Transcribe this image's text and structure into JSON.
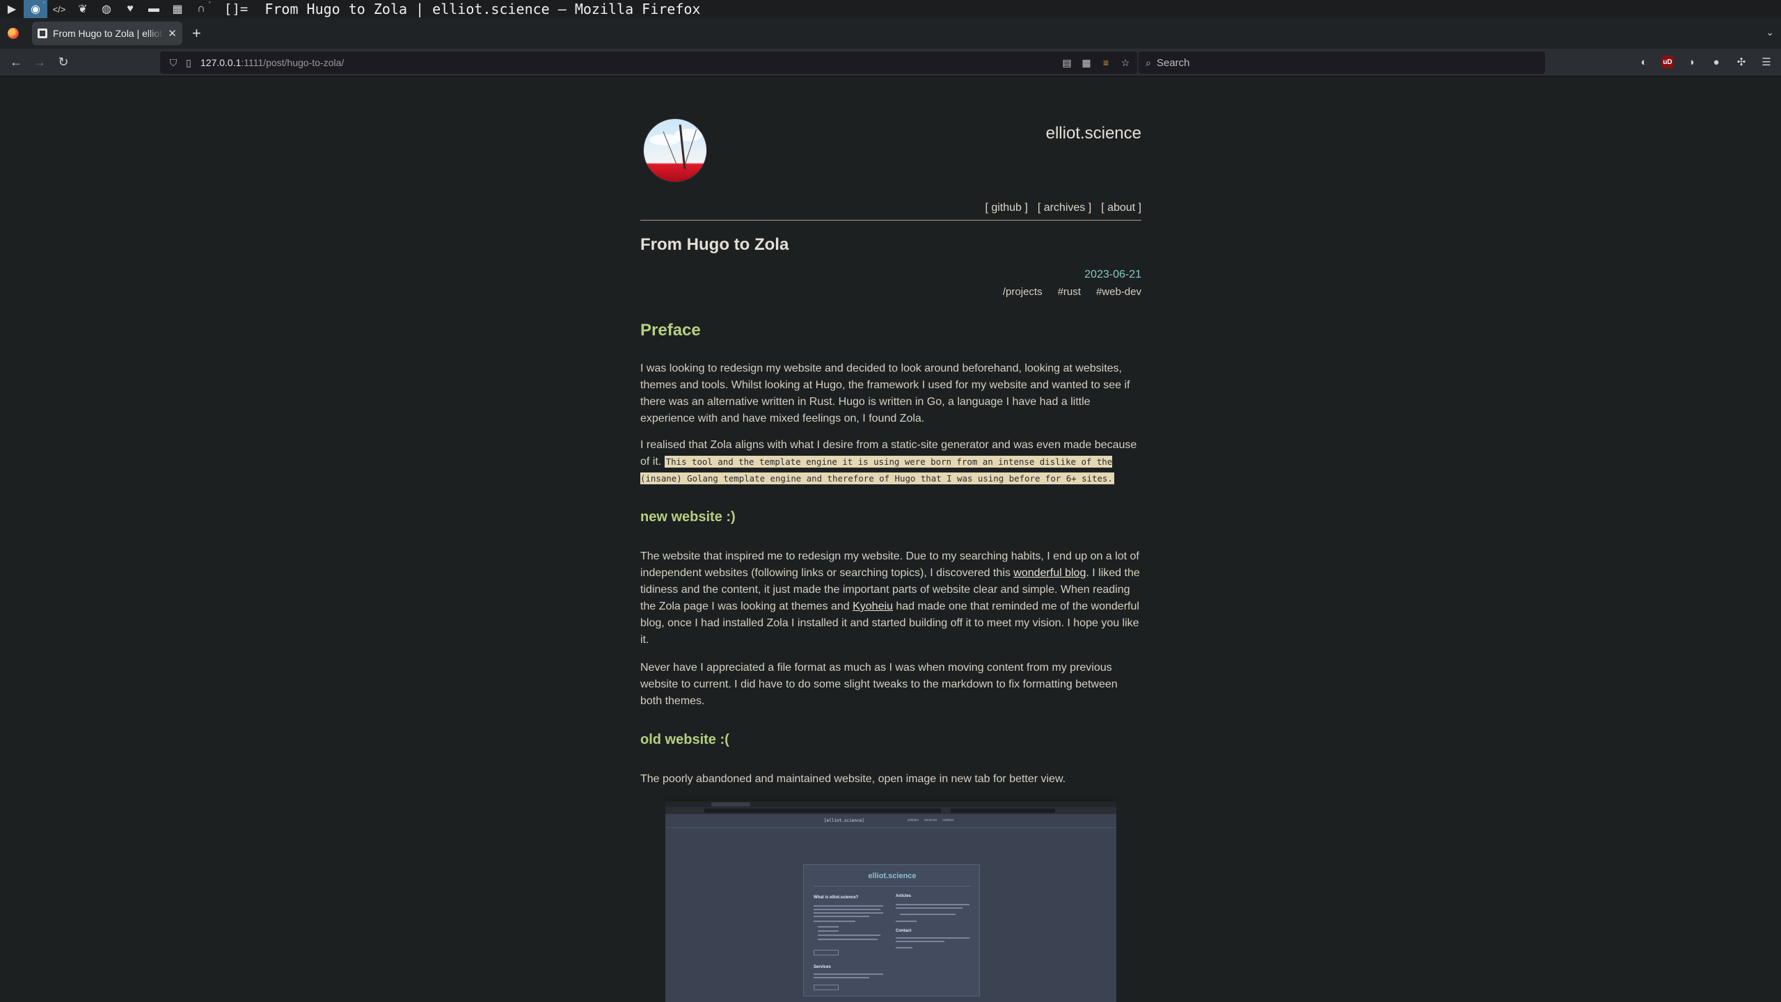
{
  "wm": {
    "layout_indicator": "[]=",
    "window_title": "From Hugo to Zola | elliot.science — Mozilla Firefox"
  },
  "browser": {
    "tab_title": "From Hugo to Zola | elliot.science",
    "url_host": "127.0.0.1",
    "url_rest": ":1111/post/hugo-to-zola/",
    "search_placeholder": "Search"
  },
  "site": {
    "title": "elliot.science",
    "nav": [
      "[ github ]",
      "[ archives ]",
      "[ about ]"
    ]
  },
  "post": {
    "title": "From Hugo to Zola",
    "date": "2023-06-21",
    "tags": [
      "/projects",
      "#rust",
      "#web-dev"
    ],
    "preface_heading": "Preface",
    "preface_p1": "I was looking to redesign my website and decided to look around beforehand, looking at websites, themes and tools. Whilst looking at Hugo, the framework I used for my website and wanted to see if there was an alternative written in Rust. Hugo is written in Go, a language I have had a little experience with and have mixed feelings on, I found Zola.",
    "preface_p2_lead": "I realised that Zola aligns with what I desire from a static-site generator and was even made because of it.",
    "preface_p2_quote": "This tool and the template engine it is using were born from an intense dislike of the (insane) Golang template engine and therefore of Hugo that I was using before for 6+ sites.",
    "new_heading": "new website :)",
    "new_p1_a": "The website that inspired me to redesign my website. Due to my searching habits, I end up on a lot of independent websites (following links or searching topics), I discovered this",
    "new_p1_link1": "wonderful blog",
    "new_p1_b": ". I liked the tidiness and the content, it just made the important parts of website clear and simple. When reading the Zola page I was looking at themes and",
    "new_p1_link2": "Kyoheiu",
    "new_p1_c": "had made one that reminded me of the wonderful blog, once I had installed Zola I installed it and started building off it to meet my vision. I hope you like it.",
    "new_p2": "Never have I appreciated a file format as much as I was when moving content from my previous website to current. I did have to do some slight tweaks to the markdown to fix formatting between both themes.",
    "old_heading": "old website :(",
    "old_p1": "The poorly abandoned and maintained website, open image in new tab for better view."
  },
  "old_screenshot": {
    "card_title": "elliot.science",
    "col1_heading": "What is elliot.science?",
    "col2_heading": "Articles",
    "col3_heading": "Contact",
    "col4_heading": "Services"
  },
  "icons": {
    "back": "arrow-left-icon",
    "forward": "arrow-right-icon",
    "reload": "reload-icon",
    "shield": "shield-icon",
    "page": "page-icon",
    "reader": "reader-view-icon",
    "qr": "qr-icon",
    "bookmark": "star-icon",
    "menu": "hamburger-icon"
  },
  "colors": {
    "page_bg": "#1d2021",
    "heading_green": "#b6d080",
    "date_teal": "#83c9c2",
    "quote_bg": "#e4d7b4"
  }
}
